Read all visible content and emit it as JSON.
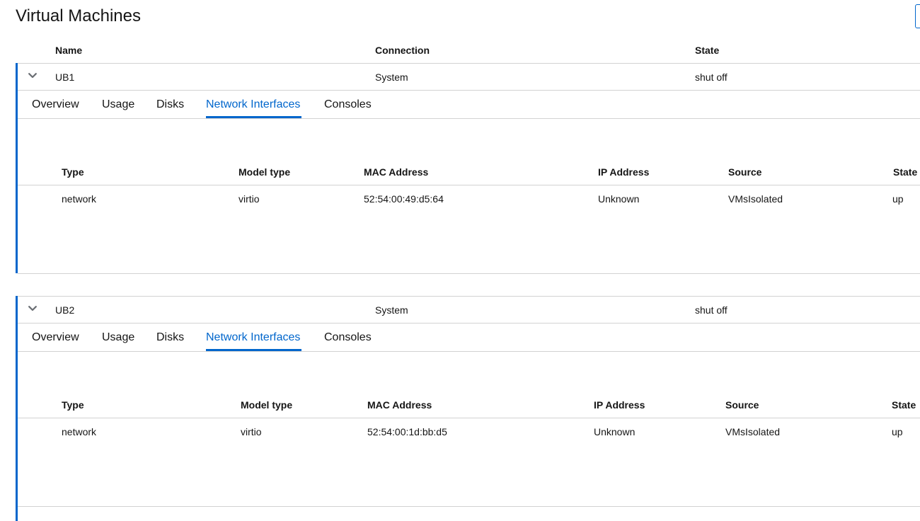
{
  "page": {
    "title": "Virtual Machines"
  },
  "vm_table": {
    "columns": [
      "Name",
      "Connection",
      "State"
    ]
  },
  "vms": [
    {
      "name": "UB1",
      "connection": "System",
      "state": "shut off",
      "tabs": [
        "Overview",
        "Usage",
        "Disks",
        "Network Interfaces",
        "Consoles"
      ],
      "active_tab": "Network Interfaces",
      "nic_columns": [
        "Type",
        "Model type",
        "MAC Address",
        "IP Address",
        "Source",
        "State"
      ],
      "nics": [
        {
          "type": "network",
          "model_type": "virtio",
          "mac": "52:54:00:49:d5:64",
          "ip": "Unknown",
          "source": "VMsIsolated",
          "state": "up"
        }
      ]
    },
    {
      "name": "UB2",
      "connection": "System",
      "state": "shut off",
      "tabs": [
        "Overview",
        "Usage",
        "Disks",
        "Network Interfaces",
        "Consoles"
      ],
      "active_tab": "Network Interfaces",
      "nic_columns": [
        "Type",
        "Model type",
        "MAC Address",
        "IP Address",
        "Source",
        "State"
      ],
      "nics": [
        {
          "type": "network",
          "model_type": "virtio",
          "mac": "52:54:00:1d:bb:d5",
          "ip": "Unknown",
          "source": "VMsIsolated",
          "state": "up"
        }
      ]
    }
  ],
  "colors": {
    "accent": "#0066cc",
    "border": "#d2d2d2",
    "text": "#151515"
  },
  "icons": {
    "expand_toggle": "chevron-down-icon"
  }
}
